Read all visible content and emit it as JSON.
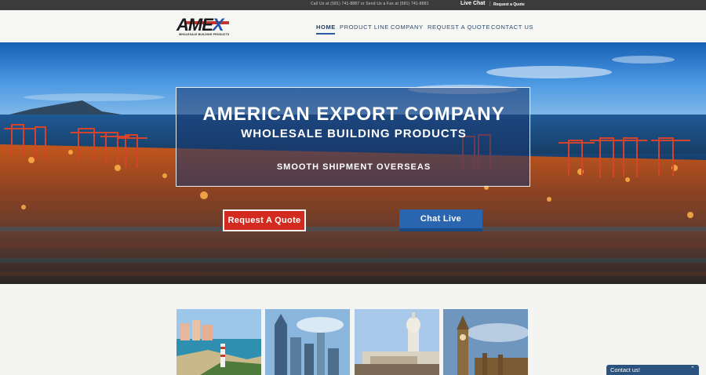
{
  "topbar": {
    "contact_text": "Call Us at (581) 741-8887 or Send Us a Fax at (581) 741-8881",
    "live_chat": "Live Chat",
    "separator": "|",
    "request_quote": "Request a Quote"
  },
  "logo": {
    "mark_left": "AM",
    "mark_mid": "E",
    "mark_right": "X",
    "tagline": "WHOLESALE BUILDING PRODUCTS"
  },
  "nav": {
    "items": [
      {
        "label": "HOME",
        "active": true
      },
      {
        "label": "PRODUCT LINE",
        "active": false
      },
      {
        "label": "COMPANY",
        "active": false
      },
      {
        "label": "REQUEST A QUOTE",
        "active": false
      },
      {
        "label": "CONTACT US",
        "active": false
      }
    ]
  },
  "hero": {
    "title": "AMERICAN EXPORT COMPANY",
    "subtitle": "WHOLESALE BUILDING PRODUCTS",
    "tagline": "SMOOTH SHIPMENT OVERSEAS",
    "quote_button": "Request A Quote",
    "chat_button": "Chat Live"
  },
  "tiles": [
    {
      "icon": "bahamas-lighthouse-image"
    },
    {
      "icon": "dubai-skyline-image"
    },
    {
      "icon": "havana-capitol-image"
    },
    {
      "icon": "london-big-ben-image"
    }
  ],
  "chat_widget": {
    "label": "Contact us!",
    "icon": "chevron-up-icon"
  },
  "colors": {
    "topbar": "#3b3b3b",
    "nav_text": "#2c4a6b",
    "accent_blue": "#2a66b0",
    "accent_red": "#d32a20"
  }
}
